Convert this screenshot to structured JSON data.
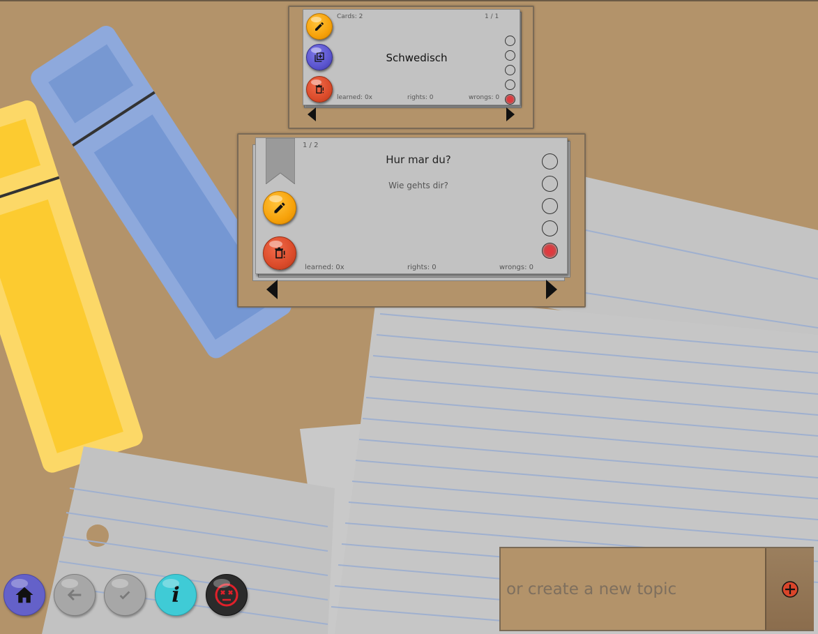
{
  "topic_card": {
    "cards_label": "Cards: 2",
    "pagination": "1 / 1",
    "title": "Schwedisch",
    "learned": "learned: 0x",
    "rights": "rights: 0",
    "wrongs": "wrongs: 0",
    "progress_active_index": 4
  },
  "flash_card": {
    "pagination": "1 / 2",
    "question": "Hur mar du?",
    "answer": "Wie gehts dir?",
    "learned": "learned: 0x",
    "rights": "rights: 0",
    "wrongs": "wrongs: 0",
    "progress_active_index": 4
  },
  "bottom_nav": {
    "buttons": [
      {
        "icon": "home-icon",
        "color": "#6461c9"
      },
      {
        "icon": "back-arrow-icon",
        "color": "#a7a7a7"
      },
      {
        "icon": "check-icon",
        "color": "#a7a7a7"
      },
      {
        "icon": "info-icon",
        "color": "#3fcbd6"
      },
      {
        "icon": "dead-face-icon",
        "color": "#2b2b2b"
      }
    ]
  },
  "new_topic": {
    "placeholder": "or create a new topic"
  },
  "colors": {
    "background": "#b3936a",
    "card": "#c2c2c2",
    "accent_orange": "#f7a20a",
    "accent_red": "#db4b2a",
    "accent_blue": "#5b55cf"
  }
}
